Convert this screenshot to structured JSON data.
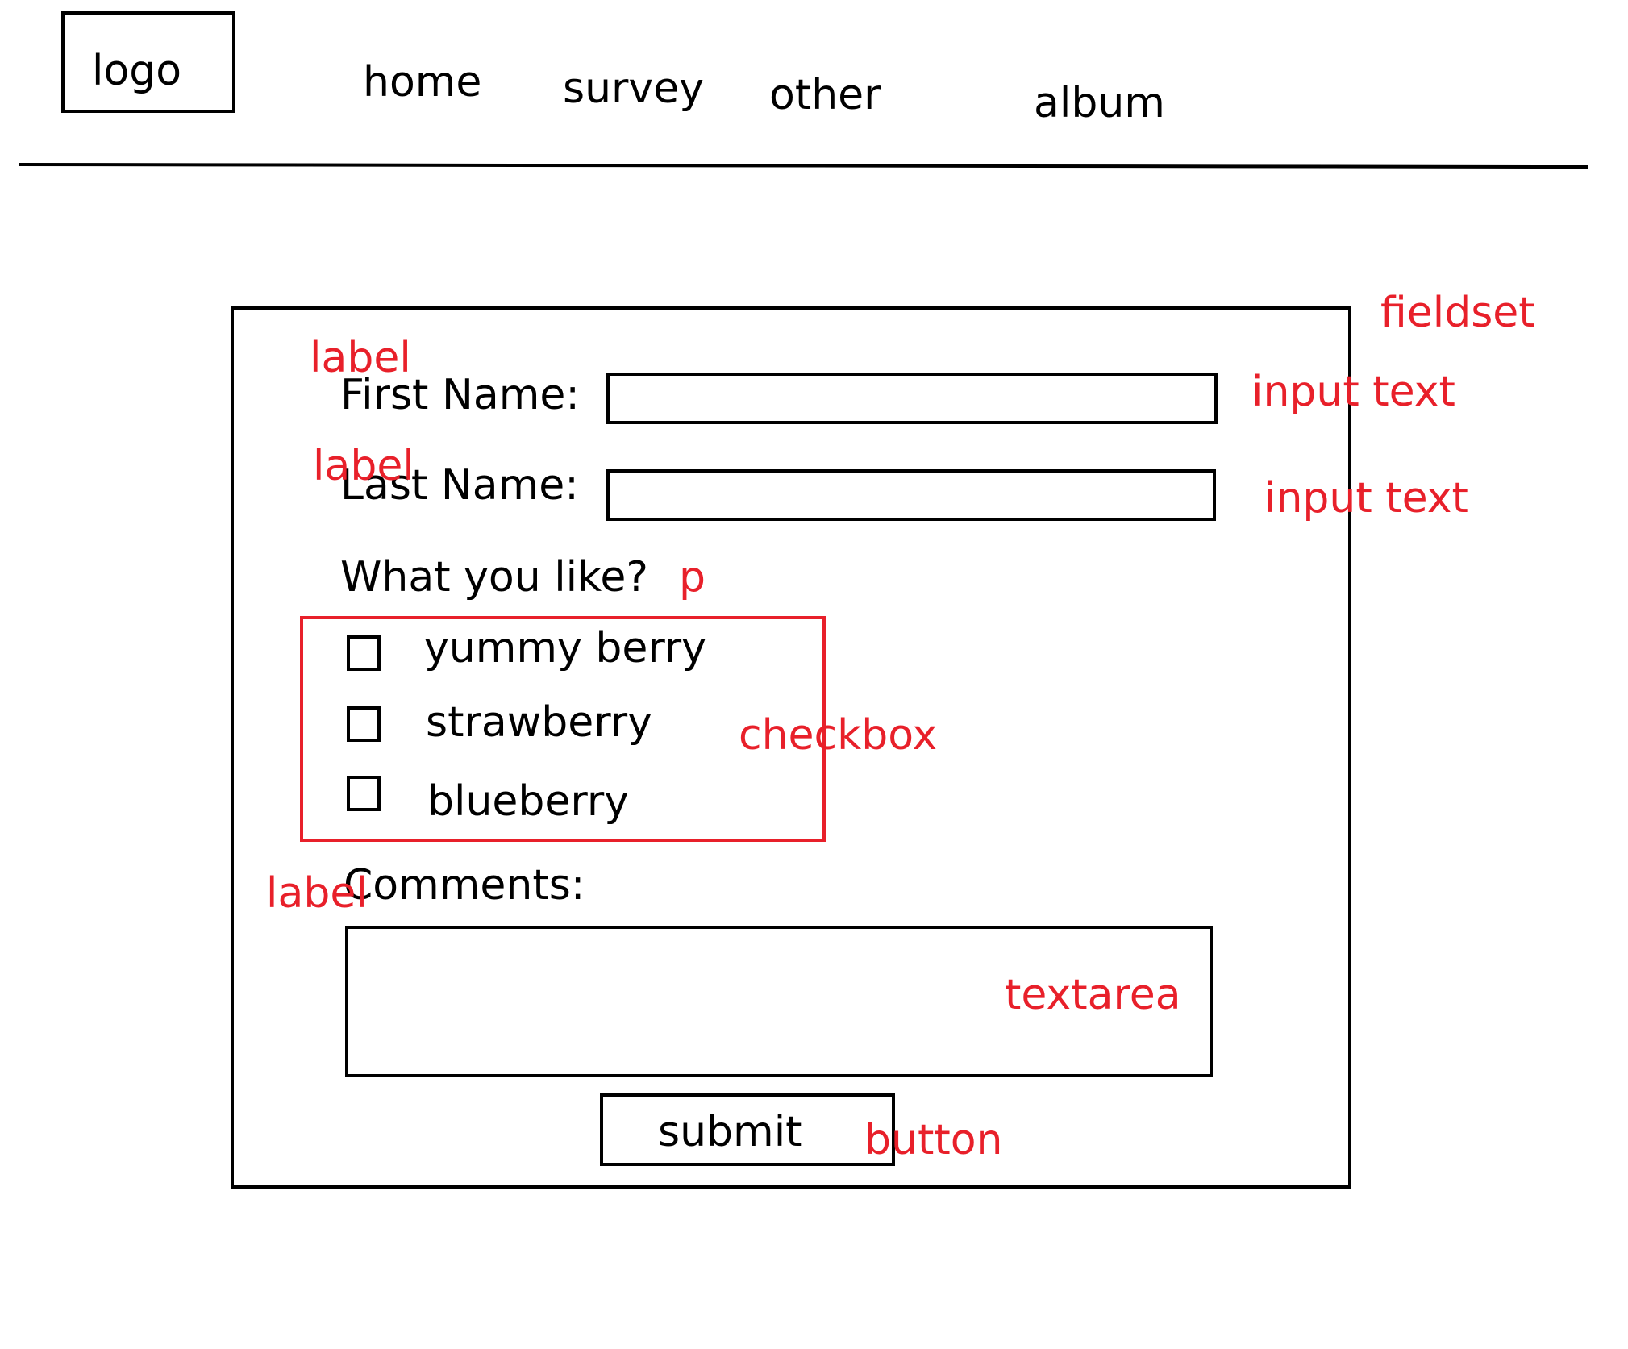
{
  "header": {
    "logo": "logo",
    "nav": [
      "home",
      "survey",
      "other",
      "album"
    ]
  },
  "form": {
    "first_name_label": "First Name:",
    "last_name_label": "Last Name:",
    "question": "What you like?",
    "options": [
      "yummy berry",
      "strawberry",
      "blueberry"
    ],
    "comments_label": "Comments:",
    "submit_label": "submit"
  },
  "annotations": {
    "fieldset": "fieldset",
    "label": "label",
    "input_text": "input text",
    "p": "p",
    "checkbox": "checkbox",
    "textarea": "textarea",
    "button": "button"
  },
  "colors": {
    "annotation": "#e8202a",
    "outline": "#000000"
  }
}
